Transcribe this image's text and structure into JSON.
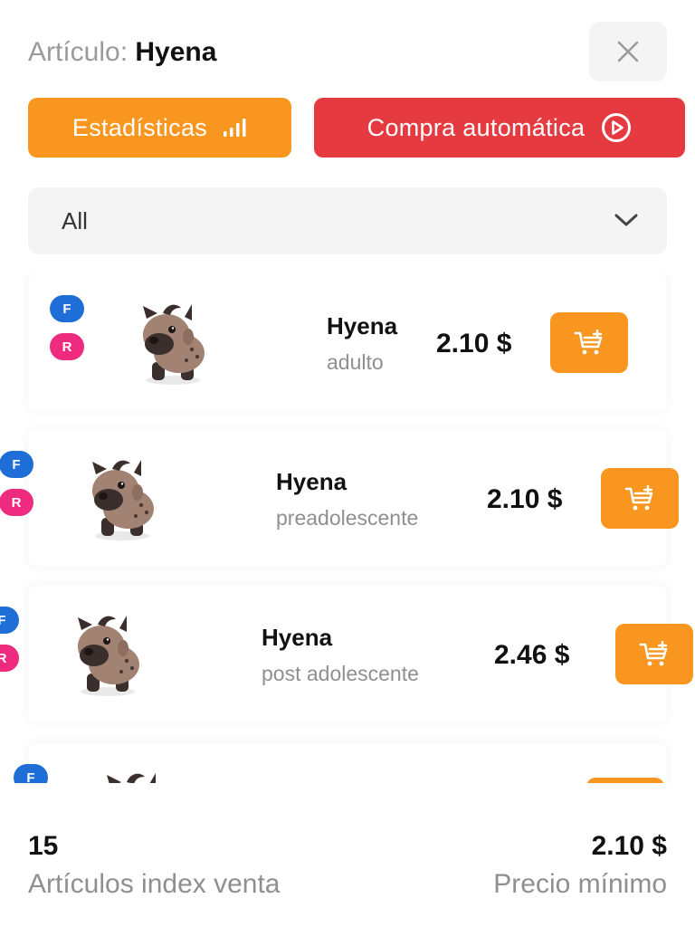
{
  "header": {
    "title_prefix": "Artículo:",
    "title_name": "Hyena"
  },
  "buttons": {
    "stats_label": "Estadísticas",
    "auto_buy_label": "Compra automática"
  },
  "filter": {
    "selected": "All"
  },
  "items": [
    {
      "name": "Hyena",
      "stage": "adulto",
      "price": "2.10 $",
      "badges": [
        "F",
        "R"
      ]
    },
    {
      "name": "Hyena",
      "stage": "preadolescente",
      "price": "2.10 $",
      "badges": [
        "F",
        "R"
      ]
    },
    {
      "name": "Hyena",
      "stage": "post adolescente",
      "price": "2.46 $",
      "badges": [
        "F",
        "R"
      ]
    },
    {
      "name": "",
      "stage": "",
      "price": "",
      "badges": [
        "F"
      ]
    }
  ],
  "footer": {
    "count": "15",
    "count_label": "Artículos index venta",
    "min_price": "2.10 $",
    "min_price_label": "Precio mínimo"
  },
  "colors": {
    "orange": "#f9961f",
    "red": "#e53a40",
    "badge_f": "#1f6ed8",
    "badge_r": "#ee2b7e"
  }
}
